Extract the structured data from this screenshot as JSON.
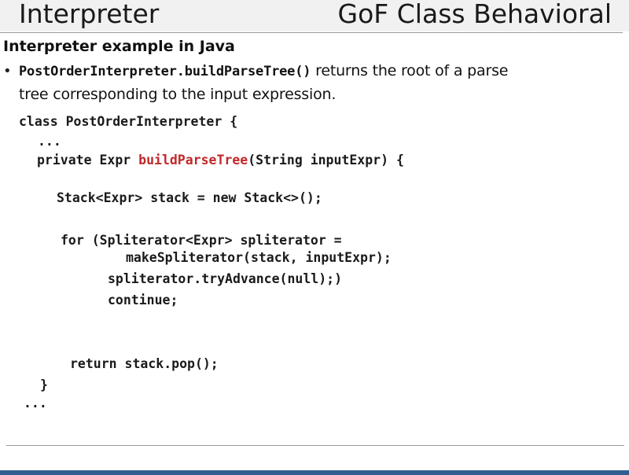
{
  "slide": {
    "title": "Interpreter",
    "category": "GoF Class Behavioral",
    "subtitle": "Interpreter example in Java",
    "bullet": {
      "code": "PostOrderInterpreter.buildParseTree()",
      "text_line1": " returns the root of a parse",
      "text_line2": "tree corresponding to the input expression."
    },
    "code": {
      "l1": "class PostOrderInterpreter {",
      "l2": "...",
      "l3_pre": "private Expr ",
      "l3_method": "buildParseTree",
      "l3_post": "(String inputExpr) {",
      "l4": "Stack<Expr> stack = new Stack<>();",
      "l5": "for (Spliterator<Expr> spliterator =",
      "l6": "makeSpliterator(stack, inputExpr);",
      "l7": "spliterator.tryAdvance(null);)",
      "l8": "continue;",
      "l9": "return stack.pop();",
      "l10": "}",
      "l11": "..."
    },
    "colors": {
      "method_highlight": "#c0282a",
      "footer_bar": "#2f5f8f"
    }
  }
}
